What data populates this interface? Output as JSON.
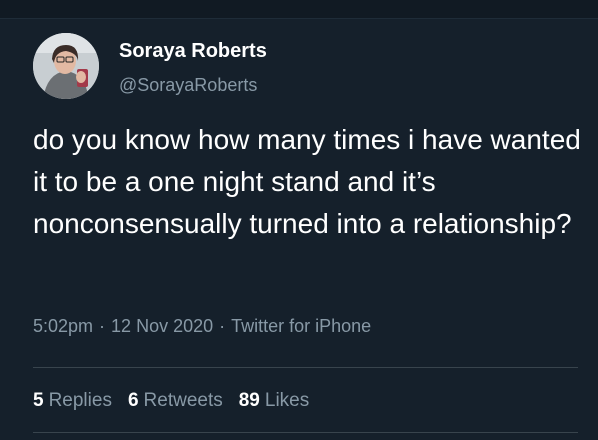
{
  "author": {
    "name": "Soraya Roberts",
    "handle": "@SorayaRoberts"
  },
  "tweet": {
    "text": "do you know how many times i have wanted it to be a one night stand and it’s nonconsensually turned into a relationship?",
    "time": "5:02pm",
    "date": "12 Nov 2020",
    "separator": "·",
    "source": "Twitter for iPhone"
  },
  "stats": {
    "replies_count": "5",
    "replies_label": "Replies",
    "retweets_count": "6",
    "retweets_label": "Retweets",
    "likes_count": "89",
    "likes_label": "Likes"
  },
  "colors": {
    "background": "#15202b",
    "primary_text": "#ffffff",
    "secondary_text": "#8899a6",
    "divider": "#38444d"
  }
}
